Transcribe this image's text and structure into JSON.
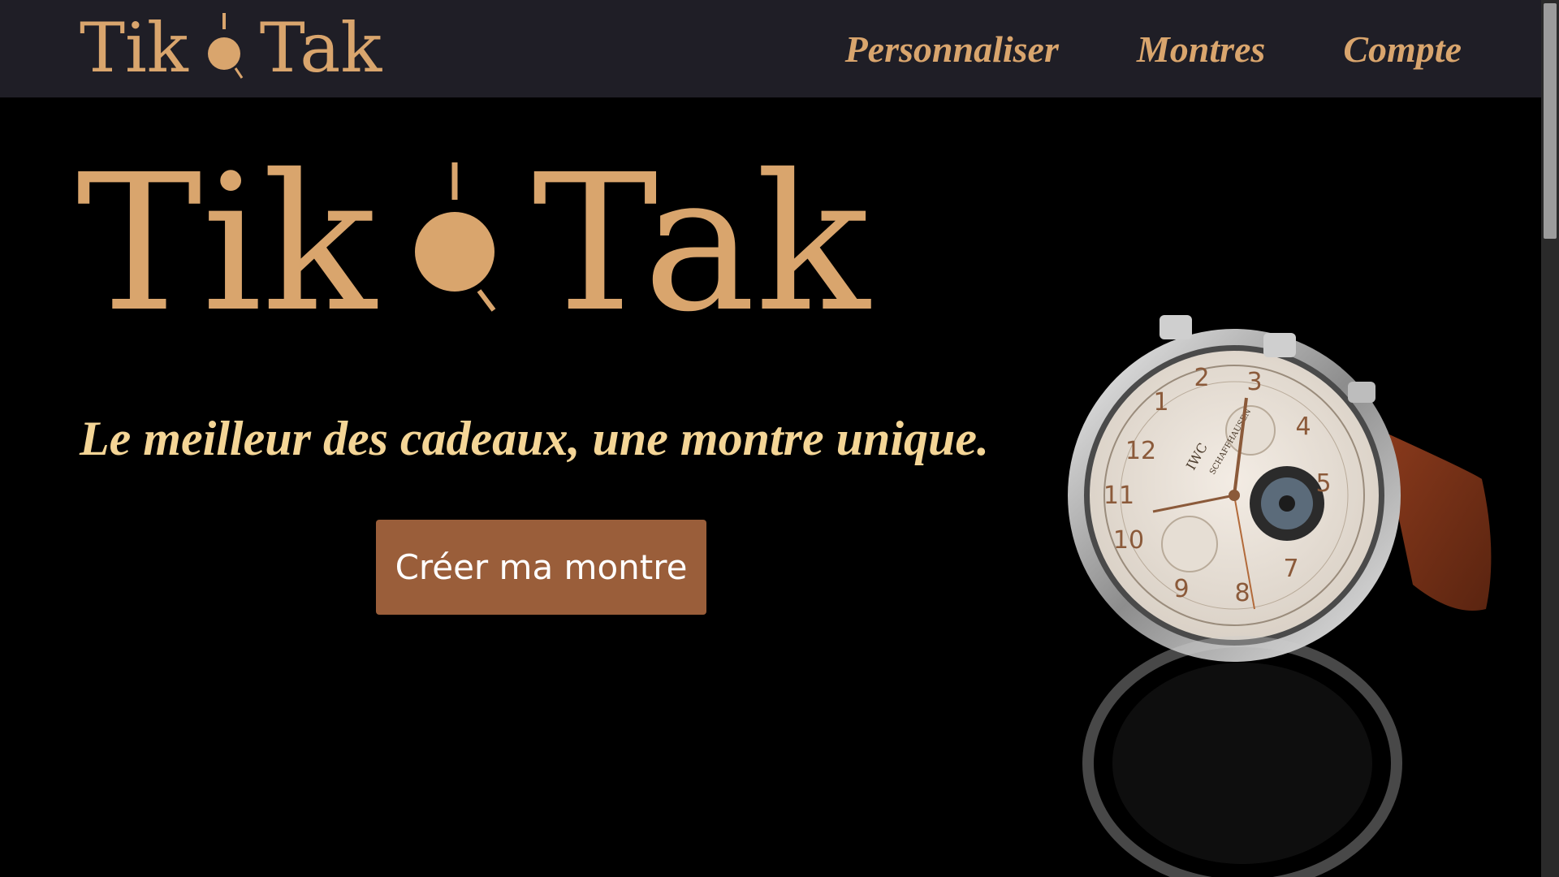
{
  "nav": {
    "logo_left": "Tik",
    "logo_right": "Tak",
    "links": [
      {
        "label": "Personnaliser"
      },
      {
        "label": "Montres"
      },
      {
        "label": "Compte"
      }
    ]
  },
  "hero": {
    "logo_left": "Tik",
    "logo_right": "Tak",
    "tagline": "Le meilleur des cadeaux, une montre unique.",
    "cta_label": "Créer ma montre"
  },
  "watch_dial": {
    "brand": "IWC",
    "maker": "SCHAFFHAUSEN",
    "numerals": [
      "12",
      "1",
      "2",
      "3",
      "4",
      "5",
      "7",
      "8",
      "9",
      "10",
      "11"
    ]
  },
  "colors": {
    "navbar_bg": "#1f1e26",
    "accent_gold": "#d9a56d",
    "tagline_gold": "#f4d596",
    "button_brown": "#9a5e3a",
    "page_bg": "#000000"
  },
  "icons": [
    "logo-clock-icon",
    "watch-image"
  ]
}
